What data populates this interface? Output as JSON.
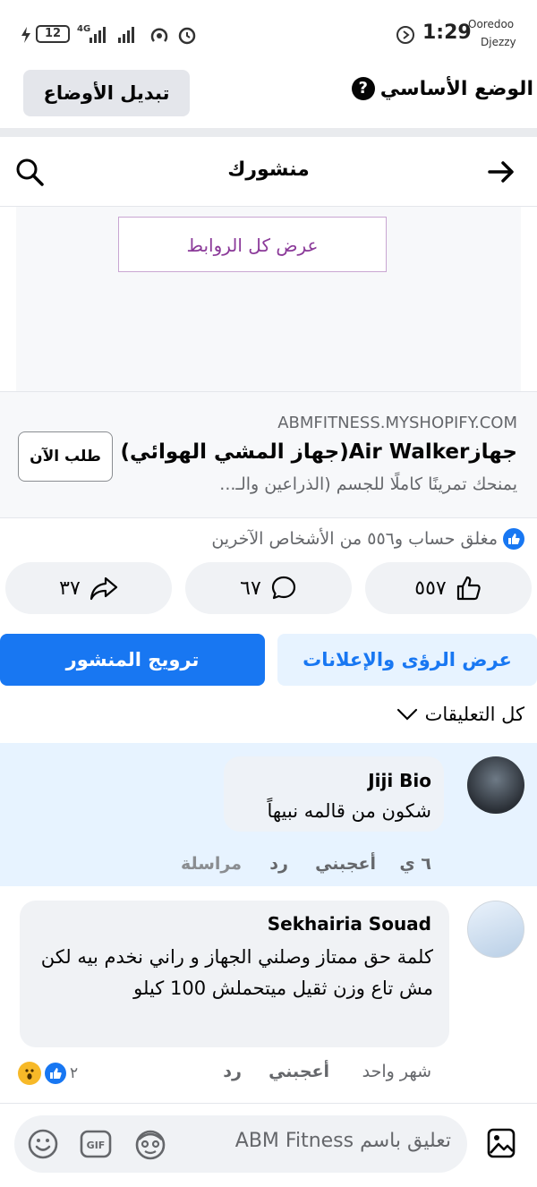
{
  "status_bar": {
    "time": "1:29",
    "carrier_1": "Ooredoo",
    "carrier_2": "Djezzy",
    "battery": "12",
    "network": "4G"
  },
  "mode_bar": {
    "switch_label": "تبديل الأوضاع",
    "mode_label": "الوضع الأساسي"
  },
  "header": {
    "title": "منشورك"
  },
  "post": {
    "view_links_label": "عرض كل الروابط",
    "ad": {
      "domain": "ABMFITNESS.MYSHOPIFY.COM",
      "title": "جهازAir Walker(جهاز المشي الهوائي)",
      "description": "يمنحك تمرينًا كاملًا للجسم (الذراعين والـ...",
      "cta": "طلب الآن"
    },
    "reactions_summary": "مغلق حساب و٥٥٦ من الأشخاص الآخرين",
    "actions": {
      "likes": "٥٥٧",
      "comments": "٦٧",
      "shares": "٣٧"
    },
    "insights_label": "عرض الرؤى والإعلانات",
    "boost_label": "ترويج المنشور"
  },
  "comments": {
    "filter_label": "كل التعليقات",
    "items": [
      {
        "author": "Jiji Bio",
        "text": "شكون من قالمه نبيهاً",
        "time": "٦ ي",
        "like": "أعجبني",
        "reply": "رد",
        "message": "مراسلة"
      },
      {
        "author": "Sekhairia Souad",
        "text": "كلمة حق ممتاز وصلني الجهاز و راني نخدم بيه لكن مش تاع وزن ثقيل  ميتحملش 100 كيلو",
        "time": "شهر واحد",
        "like": "أعجبني",
        "reply": "رد",
        "reaction_count": "٢"
      }
    ]
  },
  "composer": {
    "placeholder": "تعليق باسم ABM Fitness"
  },
  "colors": {
    "brand_blue": "#1877f2",
    "light_blue": "#e7f3ff",
    "link_purple": "#8b3a99"
  }
}
